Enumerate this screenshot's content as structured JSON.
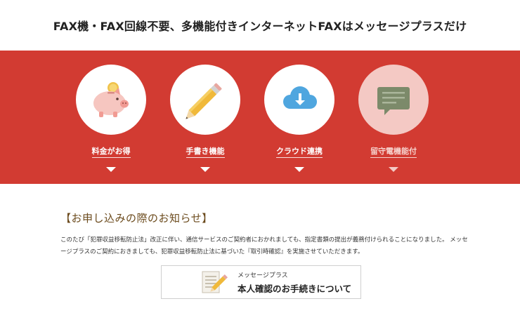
{
  "headline": "FAX機・FAX回線不要、多機能付きインターネットFAXはメッセージプラスだけ",
  "features": [
    {
      "label": "料金がお得",
      "icon": "piggy-bank-icon"
    },
    {
      "label": "手書き機能",
      "icon": "pencil-icon"
    },
    {
      "label": "クラウド連携",
      "icon": "cloud-download-icon"
    },
    {
      "label": "留守電機能付",
      "icon": "speech-bubble-icon"
    }
  ],
  "notice": {
    "title": "【お申し込みの際のお知らせ】",
    "body": "このたび「犯罪収益移転防止法」改正に伴い、通信サービスのご契約者におかれましても、指定書類の提出が義務付けられることになりました。 メッセージプラスのご契約におきましても、犯罪収益移転防止法に基づいた『取引時確認』を実施させていただきます。",
    "button_small": "メッセージプラス",
    "button_large": "本人確認のお手続きについて"
  },
  "colors": {
    "band": "#d23b32",
    "selected_circle": "#f4c9c4",
    "notice_title": "#6b4a1c"
  }
}
